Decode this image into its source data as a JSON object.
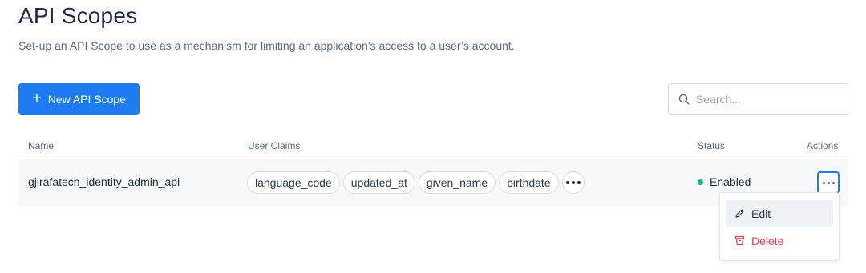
{
  "page": {
    "title": "API Scopes",
    "subtitle": "Set-up an API Scope to use as a mechanism for limiting an application’s access to a user’s account."
  },
  "toolbar": {
    "new_button_label": "New API Scope",
    "search_placeholder": "Search..."
  },
  "table": {
    "columns": {
      "name": "Name",
      "user_claims": "User Claims",
      "status": "Status",
      "actions": "Actions"
    },
    "rows": [
      {
        "name": "gjirafatech_identity_admin_api",
        "claims": [
          "language_code",
          "updated_at",
          "given_name",
          "birthdate"
        ],
        "status": "Enabled",
        "status_color": "#22b46b"
      }
    ]
  },
  "actions_menu": {
    "edit_label": "Edit",
    "delete_label": "Delete"
  },
  "colors": {
    "primary": "#1d7cf2",
    "danger": "#e3434b",
    "success": "#22b46b"
  },
  "icons": [
    "plus-icon",
    "search-icon",
    "more-icon",
    "pencil-icon",
    "trash-icon"
  ]
}
